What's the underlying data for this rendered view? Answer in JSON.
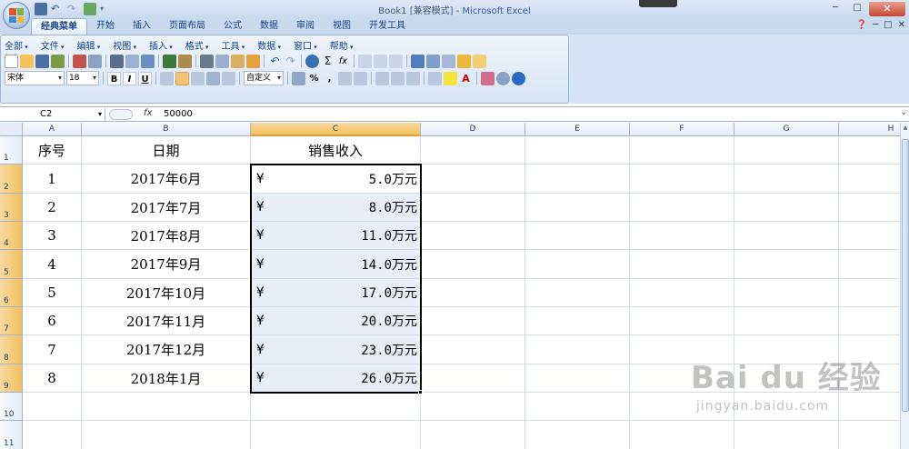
{
  "window": {
    "title": "Book1  [兼容模式] - ",
    "app": "Microsoft Excel",
    "controls": [
      "─",
      "□"
    ],
    "close": "✕"
  },
  "ribbon_tabs": [
    "经典菜单",
    "开始",
    "插入",
    "页面布局",
    "公式",
    "数据",
    "审阅",
    "视图",
    "开发工具"
  ],
  "classic_menu": [
    "全部",
    "文件",
    "编辑",
    "视图",
    "插入",
    "格式",
    "工具",
    "数据",
    "窗口",
    "帮助"
  ],
  "toolbar": {
    "font_name": "宋体",
    "font_size": "18",
    "bold": "B",
    "italic": "I",
    "underline": "U",
    "number_format": "自定义",
    "percent": "%",
    "comma": ","
  },
  "formula_bar": {
    "cell_ref": "C2",
    "fx": "fx",
    "value": "50000"
  },
  "columns": [
    "A",
    "B",
    "C",
    "D",
    "E",
    "F",
    "G",
    "H"
  ],
  "rows": [
    "1",
    "2",
    "3",
    "4",
    "5",
    "6",
    "7",
    "8",
    "9",
    "10",
    "11"
  ],
  "table": {
    "headers": [
      "序号",
      "日期",
      "销售收入"
    ],
    "rows": [
      {
        "no": "1",
        "date": "2017年6月",
        "sym": "¥",
        "amount": "5.0万元"
      },
      {
        "no": "2",
        "date": "2017年7月",
        "sym": "¥",
        "amount": "8.0万元"
      },
      {
        "no": "3",
        "date": "2017年8月",
        "sym": "¥",
        "amount": "11.0万元"
      },
      {
        "no": "4",
        "date": "2017年9月",
        "sym": "¥",
        "amount": "14.0万元"
      },
      {
        "no": "5",
        "date": "2017年10月",
        "sym": "¥",
        "amount": "17.0万元"
      },
      {
        "no": "6",
        "date": "2017年11月",
        "sym": "¥",
        "amount": "20.0万元"
      },
      {
        "no": "7",
        "date": "2017年12月",
        "sym": "¥",
        "amount": "23.0万元"
      },
      {
        "no": "8",
        "date": "2018年1月",
        "sym": "¥",
        "amount": "26.0万元"
      }
    ]
  },
  "watermark": {
    "brand": "Bai du 经验",
    "url": "jingyan.baidu.com"
  }
}
